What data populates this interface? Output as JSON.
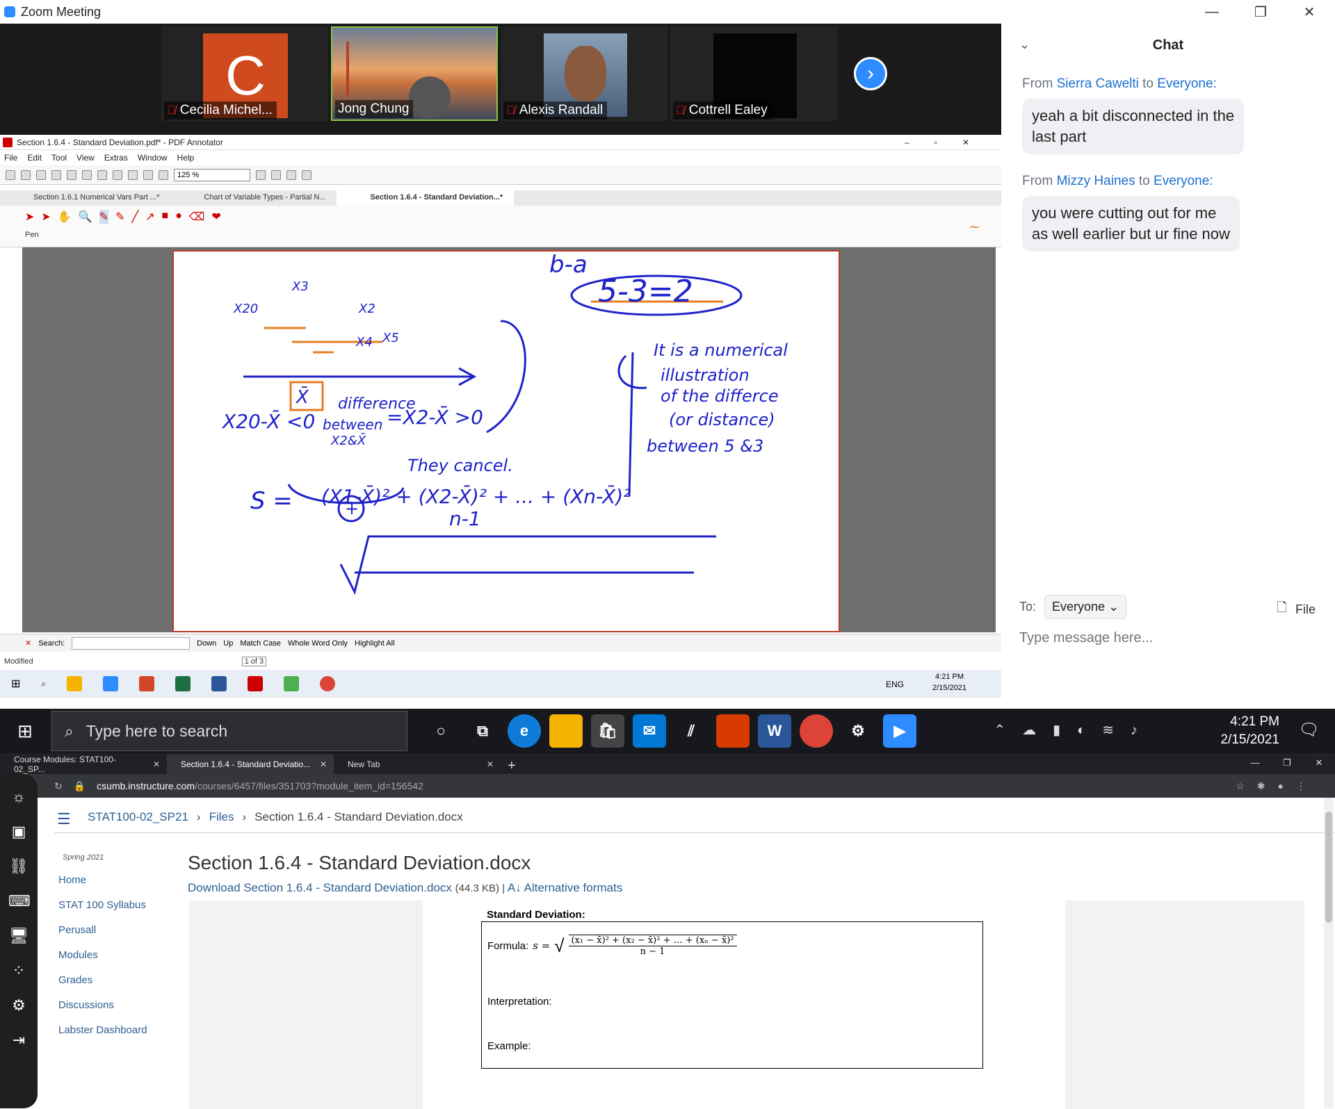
{
  "zoom": {
    "title": "Zoom Meeting",
    "participants": [
      {
        "name": "Cecilia Michel...",
        "initial": "C",
        "muted": true,
        "tile_color": "#d04a1f"
      },
      {
        "name": "Jong Chung",
        "muted": false,
        "active_speaker": true
      },
      {
        "name": "Alexis Randall",
        "muted": true
      },
      {
        "name": "Cottrell Ealey",
        "muted": true
      }
    ],
    "next_icon": "chevron-right-icon"
  },
  "chat": {
    "title": "Chat",
    "from_label": "From",
    "to_label": "to",
    "messages": [
      {
        "from": "Sierra Cawelti",
        "to": "Everyone:",
        "text_line1": "yeah a bit disconnected in the",
        "text_line2": "last part"
      },
      {
        "from": "Mizzy Haines",
        "to": "Everyone:",
        "text_line1": "you were cutting out for me",
        "text_line2": "as well earlier but ur fine now"
      }
    ],
    "to_prefix": "To:",
    "recipient": "Everyone",
    "file_label": "File",
    "input_placeholder": "Type message here..."
  },
  "pdf_annotator": {
    "window_title": "Section 1.6.4 - Standard Deviation.pdf* - PDF Annotator",
    "menu": [
      "File",
      "Edit",
      "Tool",
      "View",
      "Extras",
      "Window",
      "Help"
    ],
    "zoom": "125 %",
    "tabs": [
      "Section 1.6.1 Numerical Vars Part ...*",
      "Chart of Variable Types - Partial N...",
      "Section 1.6.4 - Standard Deviation...*"
    ],
    "pen_label": "Pen",
    "search_label": "Search:",
    "down_label": "Down",
    "up_label": "Up",
    "match_case": "Match Case",
    "whole_word": "Whole Word Only",
    "highlight_all": "Highlight All",
    "status": "Modified",
    "page_indicator": "1 of 3",
    "inner_clock_time": "4:21 PM",
    "inner_clock_date": "2/15/2021",
    "inner_lang": "ENG",
    "handwriting": {
      "top": "b-a",
      "circled": "5-3=2",
      "note": [
        "It is a numerical",
        "illustration",
        "of the differce",
        "(or distance)",
        "between 5 &3"
      ],
      "labels": [
        "X20",
        "X2",
        "X3",
        "X4",
        "X5",
        "X̄"
      ],
      "ineq_left": "X20-X̄ <0",
      "difference": "difference",
      "between": "between",
      "between_sub": "X2&X̄",
      "ineq_right": "=X2-X̄ >0",
      "plus": "+",
      "cancel": "They cancel.",
      "formula_lhs": "S =",
      "formula_num": "(X1-X̄)² + (X2-X̄)² + ... + (Xn-X̄)²",
      "formula_den": "n-1"
    }
  },
  "taskbar": {
    "search_placeholder": "Type here to search",
    "time": "4:21 PM",
    "date": "2/15/2021"
  },
  "browser": {
    "tabs": [
      {
        "title": "Course Modules: STAT100-02_SP..."
      },
      {
        "title": "Section 1.6.4 - Standard Deviatio...",
        "active": true
      },
      {
        "title": "New Tab"
      }
    ],
    "url_host": "csumb.instructure.com",
    "url_path": "/courses/6457/files/351703?module_item_id=156542"
  },
  "canvas": {
    "breadcrumb": [
      "STAT100-02_SP21",
      "Files",
      "Section 1.6.4 - Standard Deviation.docx"
    ],
    "term": "Spring 2021",
    "nav": [
      "Home",
      "STAT 100 Syllabus",
      "Perusall",
      "Modules",
      "Grades",
      "Discussions",
      "Labster Dashboard"
    ],
    "title": "Section 1.6.4 - Standard Deviation.docx",
    "download_label": "Download Section 1.6.4 - Standard Deviation.docx",
    "size": "(44.3 KB) |",
    "alt_formats": "Alternative formats",
    "doc": {
      "heading": "Standard Deviation:",
      "formula_label": "Formula:",
      "formula_lhs": "s =",
      "formula_num": "(x₁ − x̄)² + (x₂ − x̄)² + … + (xₙ − x̄)²",
      "formula_den": "n − 1",
      "interpretation_label": "Interpretation:",
      "example_label": "Example:"
    }
  }
}
